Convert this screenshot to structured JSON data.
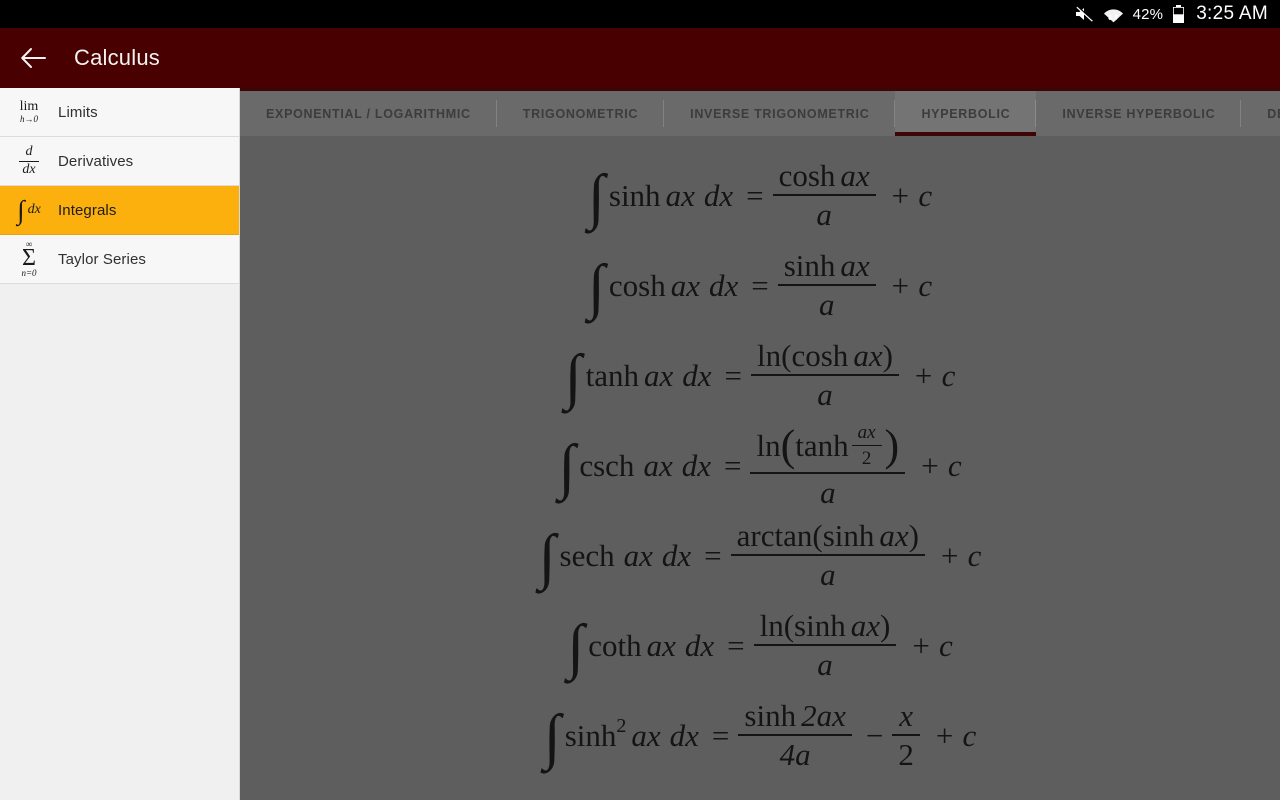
{
  "status_bar": {
    "volume_icon": "volume-muted-icon",
    "wifi_icon": "wifi-data-icon",
    "battery_percent": "42%",
    "battery_icon": "battery-icon",
    "clock": "3:25 AM"
  },
  "app_bar": {
    "back_icon": "back-arrow-icon",
    "title": "Calculus",
    "color": "#480000"
  },
  "sidebar": {
    "accent_color": "#fbb00d",
    "items": [
      {
        "label": "Limits",
        "icon": "limit-icon",
        "active": false
      },
      {
        "label": "Derivatives",
        "icon": "derivative-icon",
        "active": false
      },
      {
        "label": "Integrals",
        "icon": "integral-icon",
        "active": true
      },
      {
        "label": "Taylor Series",
        "icon": "summation-icon",
        "active": false
      }
    ]
  },
  "tabs": {
    "selected": "HYPERBOLIC",
    "items": [
      {
        "label": "EXPONENTIAL / LOGARITHMIC"
      },
      {
        "label": "TRIGONOMETRIC"
      },
      {
        "label": "INVERSE TRIGONOMETRIC"
      },
      {
        "label": "HYPERBOLIC"
      },
      {
        "label": "INVERSE HYPERBOLIC"
      },
      {
        "label": "DEFINITE INTEGRALS"
      }
    ]
  },
  "formulas": [
    {
      "integrand": "sinh",
      "var": "ax",
      "dx": "dx",
      "eq": "=",
      "numerator": "cosh ax",
      "denominator": "a",
      "tail": "+ c",
      "plain": "∫ sinh ax dx = cosh ax / a + c"
    },
    {
      "integrand": "cosh",
      "var": "ax",
      "dx": "dx",
      "eq": "=",
      "numerator": "sinh ax",
      "denominator": "a",
      "tail": "+ c",
      "plain": "∫ cosh ax dx = sinh ax / a + c"
    },
    {
      "integrand": "tanh",
      "var": "ax",
      "dx": "dx",
      "eq": "=",
      "numerator": "ln(cosh ax)",
      "denominator": "a",
      "tail": "+ c",
      "plain": "∫ tanh ax dx = ln(cosh ax) / a + c"
    },
    {
      "integrand": "csch",
      "var": "ax",
      "dx": "dx",
      "eq": "=",
      "numerator": "ln(tanh ax/2)",
      "denominator": "a",
      "tail": "+ c",
      "plain": "∫ csch ax dx = ln(tanh (ax/2)) / a + c"
    },
    {
      "integrand": "sech",
      "var": "ax",
      "dx": "dx",
      "eq": "=",
      "numerator": "arctan(sinh ax)",
      "denominator": "a",
      "tail": "+ c",
      "plain": "∫ sech ax dx = arctan(sinh ax) / a + c"
    },
    {
      "integrand": "coth",
      "var": "ax",
      "dx": "dx",
      "eq": "=",
      "numerator": "ln(sinh ax)",
      "denominator": "a",
      "tail": "+ c",
      "plain": "∫ coth ax dx = ln(sinh ax) / a + c"
    },
    {
      "integrand": "sinh",
      "power": "2",
      "var": "ax",
      "dx": "dx",
      "eq": "=",
      "numerator": "sinh 2ax",
      "denominator": "4a",
      "minus": "−",
      "numerator2": "x",
      "denominator2": "2",
      "tail": "+ c",
      "plain": "∫ sinh² ax dx = sinh 2ax / 4a − x/2 + c"
    }
  ],
  "glyphs": {
    "integral": "∫",
    "equals": "=",
    "plus_c": "+ c",
    "minus": "−",
    "sigma": "Σ",
    "infinity": "∞",
    "lim": "lim",
    "lim_sub": "h→0",
    "d": "d",
    "dx": "dx",
    "n0": "n=0",
    "ln": "ln",
    "arctan": "arctan",
    "sinh": "sinh",
    "cosh": "cosh",
    "tanh": "tanh",
    "csch": "csch",
    "sech": "sech",
    "coth": "coth",
    "ax": "ax",
    "a": "a",
    "two": "2",
    "four_a": "4a",
    "two_ax": "2ax",
    "x": "x",
    "lparen": "(",
    "rparen": ")",
    "sup2": "2"
  },
  "colors": {
    "content_bg": "#5e5e5e",
    "tabstrip_bg": "#6a6a6a",
    "sidebar_bg": "#f0f0f0",
    "accent": "#fbb00d",
    "appbar": "#480000",
    "tab_underline": "#3d0606"
  }
}
